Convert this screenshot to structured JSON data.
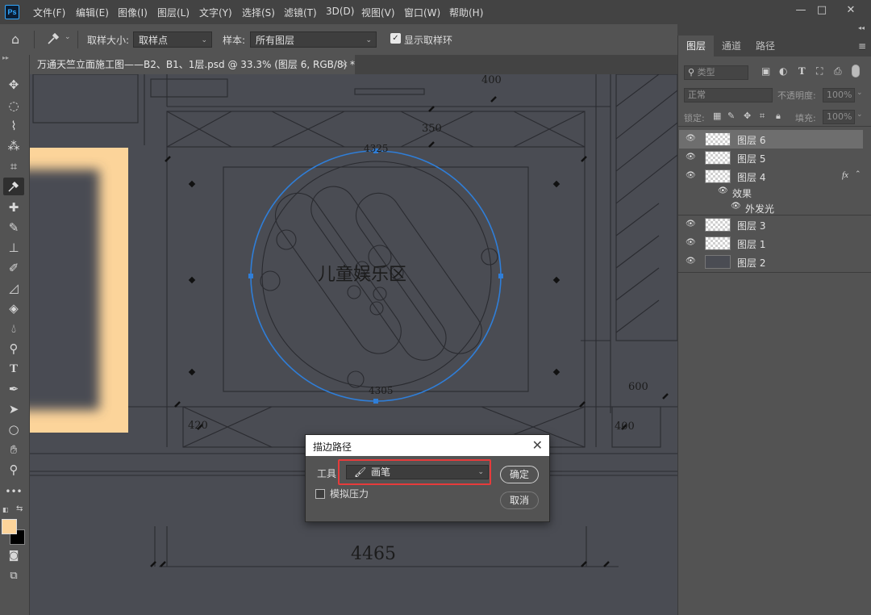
{
  "app": {
    "logo_text": "Ps"
  },
  "menu": [
    "文件(F)",
    "编辑(E)",
    "图像(I)",
    "图层(L)",
    "文字(Y)",
    "选择(S)",
    "滤镜(T)",
    "3D(D)",
    "视图(V)",
    "窗口(W)",
    "帮助(H)"
  ],
  "window_controls": {
    "minimize": "—",
    "maximize": "□",
    "close": "✕"
  },
  "options_bar": {
    "sample_size_label": "取样大小:",
    "sample_size_value": "取样点",
    "sample_label": "样本:",
    "sample_value": "所有图层",
    "show_ring_label": "显示取样环",
    "show_ring_checked": true
  },
  "document_tab": {
    "title": "万通天竺立面施工图——B2、B1、1层.psd @ 33.3% (图层 6, RGB/8) *",
    "close": "×"
  },
  "canvas": {
    "area_label": "儿童娱乐区",
    "dims": [
      "4465",
      "4305",
      "4325",
      "400",
      "350",
      "600",
      "420",
      "400"
    ]
  },
  "panel": {
    "tabs": [
      "图层",
      "通道",
      "路径"
    ],
    "filter_placeholder": "类型",
    "blend_mode": "正常",
    "opacity_label": "不透明度:",
    "opacity_value": "100%",
    "lock_label": "锁定:",
    "fill_label": "填充:",
    "fill_value": "100%",
    "layers": [
      {
        "name": "图层 6",
        "selected": true
      },
      {
        "name": "图层 5"
      },
      {
        "name": "图层 4",
        "fx": "fx"
      },
      {
        "name": "效果",
        "sub": true
      },
      {
        "name": "外发光",
        "sub2": true
      },
      {
        "name": "图层 3"
      },
      {
        "name": "图层 1"
      },
      {
        "name": "图层 2",
        "solid": true
      }
    ]
  },
  "dialog": {
    "title": "描边路径",
    "tool_label": "工具",
    "tool_value": "画笔",
    "simulate_pressure_label": "模拟压力",
    "ok_label": "确定",
    "cancel_label": "取消"
  },
  "colors": {
    "foreground": "#fcd49a",
    "background": "#000000",
    "highlight": "#e63b3b",
    "path": "#2f7ed8",
    "glow_fill": "#fcd49a"
  }
}
